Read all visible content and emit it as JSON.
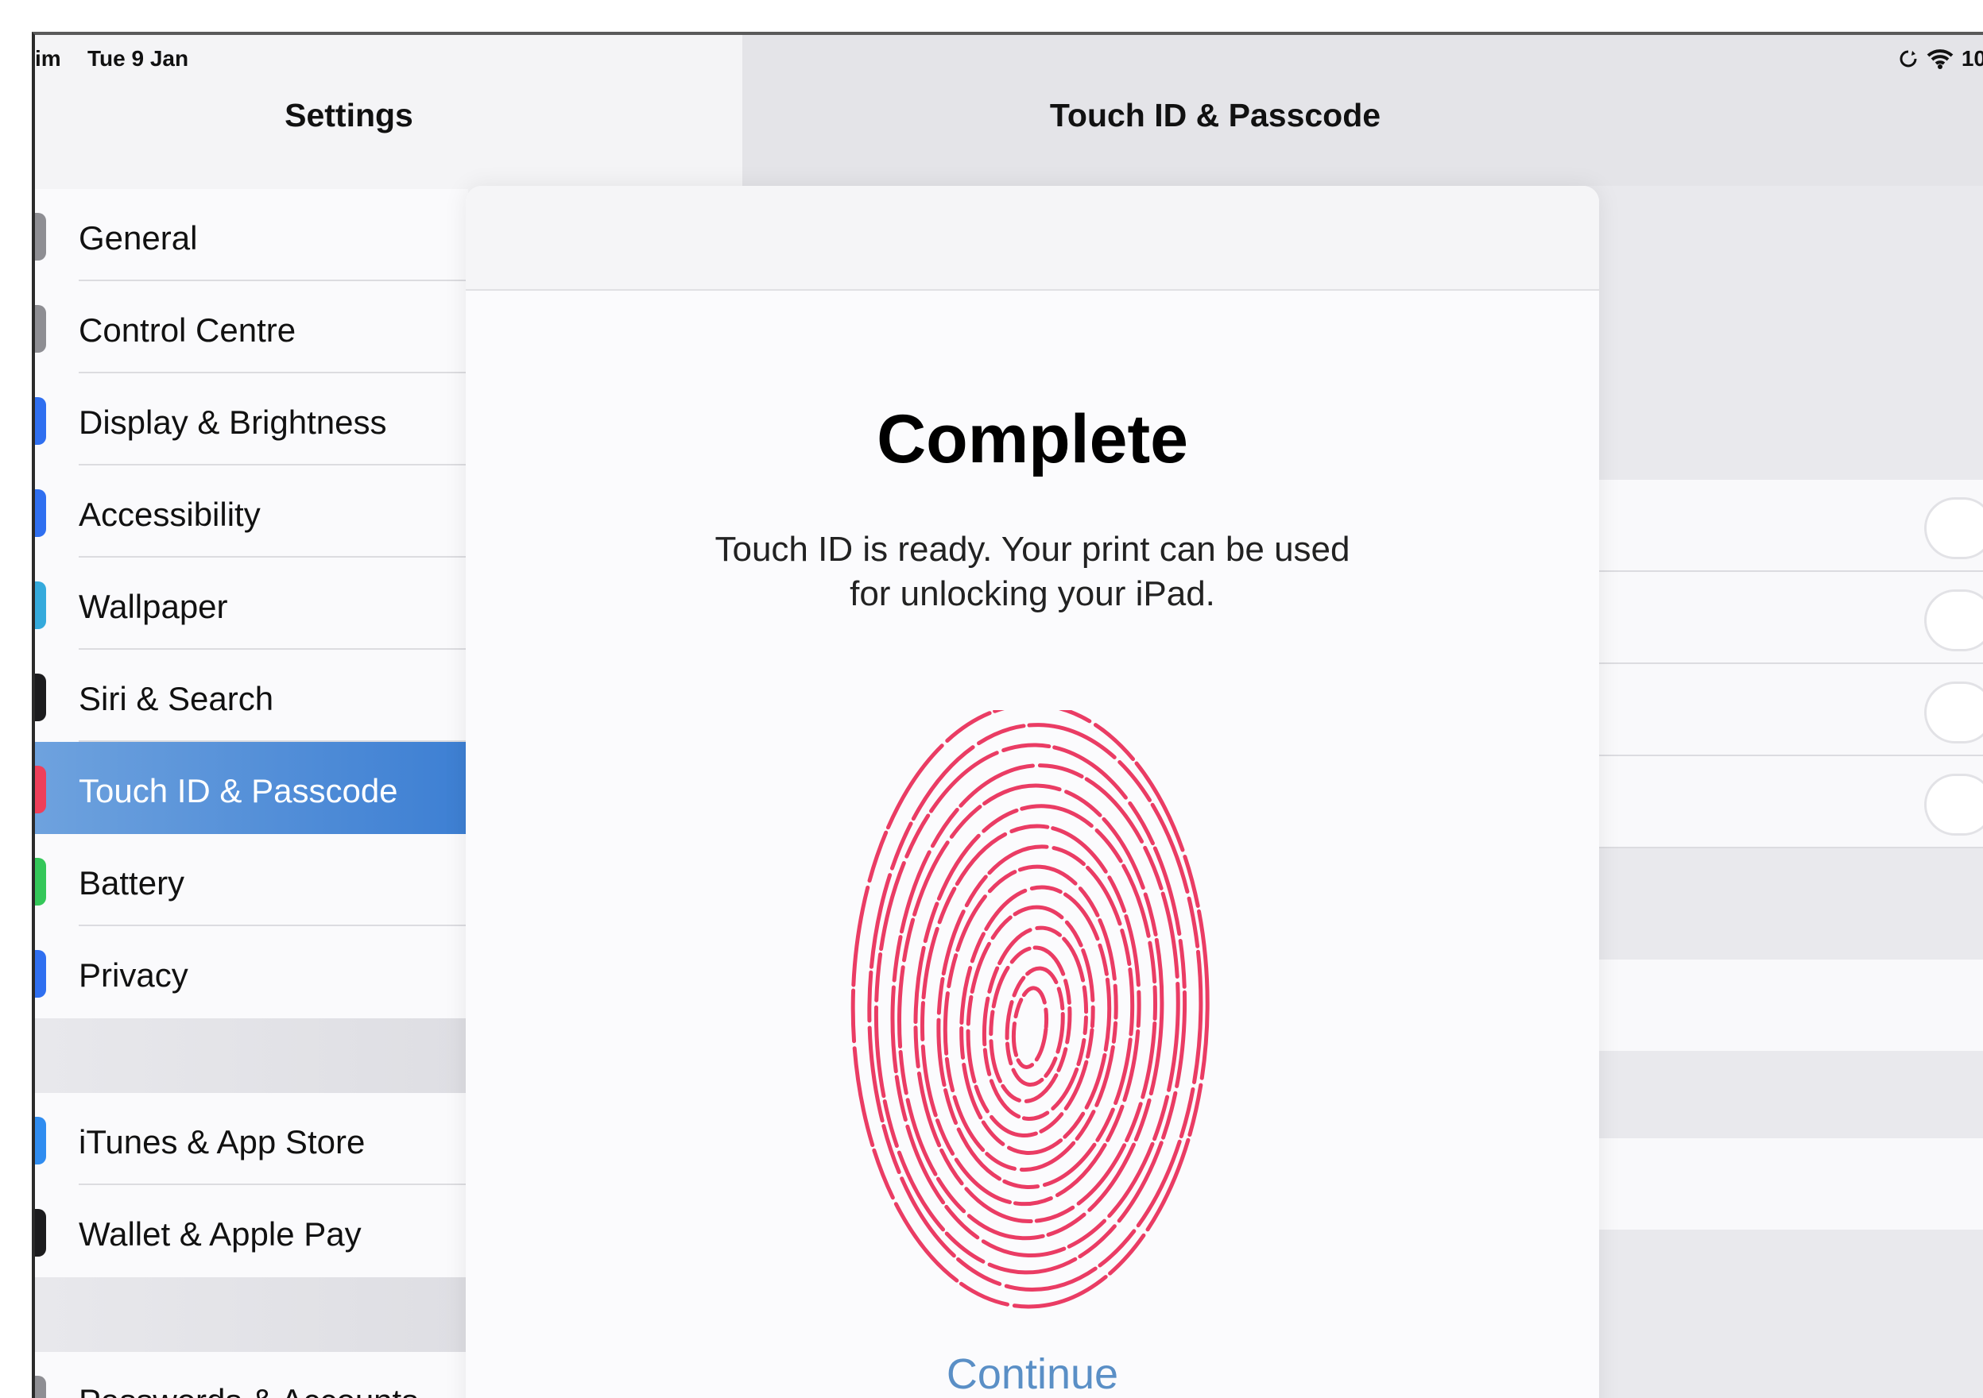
{
  "status_bar": {
    "time": "im",
    "date": "Tue 9 Jan",
    "battery": "10"
  },
  "sidebar": {
    "title": "Settings",
    "items": [
      {
        "label": "General",
        "icon": "gear-icon",
        "color": "#8e8e93"
      },
      {
        "label": "Control Centre",
        "icon": "control-centre-icon",
        "color": "#8e8e93"
      },
      {
        "label": "Display & Brightness",
        "icon": "brightness-icon",
        "color": "#2f6ff0"
      },
      {
        "label": "Accessibility",
        "icon": "accessibility-icon",
        "color": "#2f6ff0"
      },
      {
        "label": "Wallpaper",
        "icon": "wallpaper-icon",
        "color": "#35aadc"
      },
      {
        "label": "Siri & Search",
        "icon": "siri-icon",
        "color": "#1c1c1e"
      },
      {
        "label": "Touch ID & Passcode",
        "icon": "fingerprint-icon",
        "color": "#ef3f5a",
        "selected": true
      },
      {
        "label": "Battery",
        "icon": "battery-icon",
        "color": "#34c759"
      },
      {
        "label": "Privacy",
        "icon": "hand-icon",
        "color": "#2f6ff0"
      },
      {
        "label": "iTunes & App Store",
        "icon": "app-store-icon",
        "color": "#2f8cf0"
      },
      {
        "label": "Wallet & Apple Pay",
        "icon": "wallet-icon",
        "color": "#1c1c1e"
      },
      {
        "label": "Passwords & Accounts",
        "icon": "key-icon",
        "color": "#8e8e93"
      }
    ]
  },
  "detail": {
    "title": "Touch ID & Passcode"
  },
  "modal": {
    "title": "Complete",
    "description_line1": "Touch ID is ready. Your print can be used",
    "description_line2": "for unlocking your iPad.",
    "continue_label": "Continue",
    "accent_color": "#ea3c64",
    "link_color": "#5a8fc6"
  }
}
